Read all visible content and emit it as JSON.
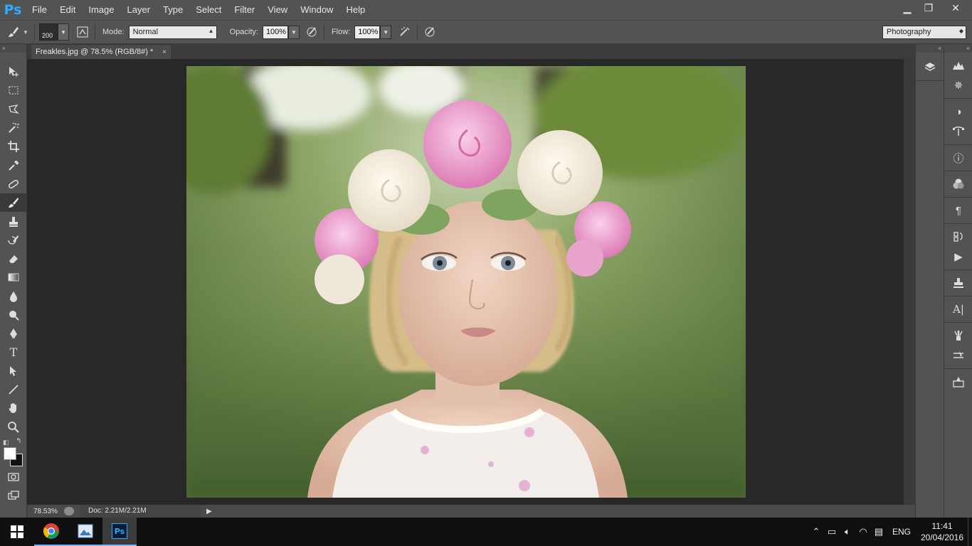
{
  "app": {
    "logo": "Ps"
  },
  "menu": [
    "File",
    "Edit",
    "Image",
    "Layer",
    "Type",
    "Select",
    "Filter",
    "View",
    "Window",
    "Help"
  ],
  "window_controls": {
    "minimize": "▁",
    "restore": "❐",
    "close": "✕"
  },
  "options": {
    "brush_size": "200",
    "mode_label": "Mode:",
    "mode_value": "Normal",
    "opacity_label": "Opacity:",
    "opacity_value": "100%",
    "flow_label": "Flow:",
    "flow_value": "100%",
    "workspace": "Photography"
  },
  "document": {
    "tab_title": "Freakles.jpg @ 78.5% (RGB/8#) *",
    "close": "×"
  },
  "status": {
    "zoom": "78.53%",
    "doc": "Doc: 2.21M/2.21M"
  },
  "tools": [
    "move-icon",
    "marquee-icon",
    "lasso-icon",
    "magic-wand-icon",
    "crop-icon",
    "eyedropper-icon",
    "healing-brush-icon",
    "brush-icon",
    "clone-stamp-icon",
    "history-brush-icon",
    "eraser-icon",
    "gradient-icon",
    "blur-icon",
    "dodge-icon",
    "pen-icon",
    "type-icon",
    "path-selection-icon",
    "line-icon",
    "hand-icon",
    "zoom-icon"
  ],
  "taskbar": {
    "lang": "ENG",
    "time": "11:41",
    "date": "20/04/2016"
  }
}
